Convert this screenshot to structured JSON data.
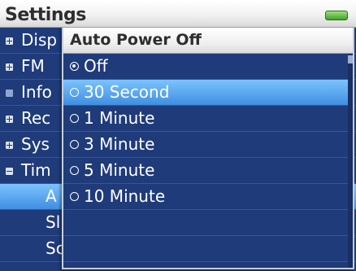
{
  "header": {
    "title": "Settings"
  },
  "icons": {
    "battery": "battery-icon",
    "expand": "plus-box-icon",
    "collapse": "minus-box-icon",
    "leaf": "square-bullet-icon",
    "radio_on": "radio-checked-icon",
    "radio_off": "radio-unchecked-icon"
  },
  "colors": {
    "list_background": "#1f3b7a",
    "highlight": "#5aa8f2",
    "header_background": "#f2f2f2",
    "battery": "#4fb434"
  },
  "settings_list": {
    "items": [
      {
        "label": "Disp",
        "kind": "expand"
      },
      {
        "label": "FM",
        "kind": "expand"
      },
      {
        "label": "Info",
        "kind": "leaf"
      },
      {
        "label": "Rec",
        "kind": "expand"
      },
      {
        "label": "Sys",
        "kind": "expand"
      },
      {
        "label": "Tim",
        "kind": "collapse"
      },
      {
        "label": "A",
        "kind": "sub",
        "selected": true
      },
      {
        "label": "Sl",
        "kind": "sub"
      },
      {
        "label": "Sc",
        "kind": "sub"
      }
    ]
  },
  "popup": {
    "title": "Auto Power Off",
    "options": [
      {
        "label": "Off",
        "checked": true,
        "highlighted": false
      },
      {
        "label": "30 Second",
        "checked": false,
        "highlighted": true
      },
      {
        "label": "1 Minute",
        "checked": false,
        "highlighted": false
      },
      {
        "label": "3 Minute",
        "checked": false,
        "highlighted": false
      },
      {
        "label": "5 Minute",
        "checked": false,
        "highlighted": false
      },
      {
        "label": "10 Minute",
        "checked": false,
        "highlighted": false
      }
    ]
  }
}
